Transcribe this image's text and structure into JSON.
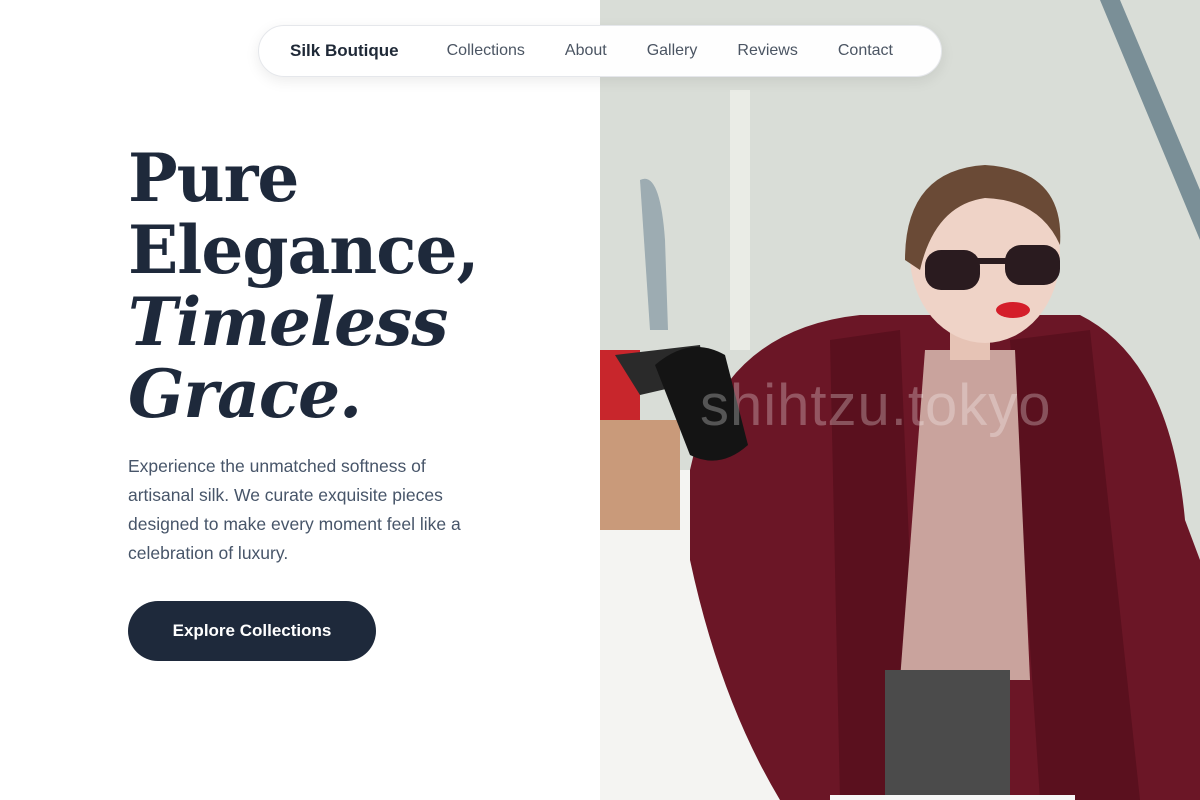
{
  "nav": {
    "brand": "Silk Boutique",
    "links": [
      "Collections",
      "About",
      "Gallery",
      "Reviews",
      "Contact"
    ]
  },
  "hero": {
    "headline_line1": "Pure",
    "headline_line2": "Elegance,",
    "headline_line3": "Timeless",
    "headline_line4": "Grace.",
    "description": "Experience the unmatched softness of artisanal silk. We curate exquisite pieces designed to make every moment feel like a celebration of luxury.",
    "cta_label": "Explore Collections",
    "image_watermark": "shihtzu.tokyo"
  },
  "colors": {
    "primary": "#1e293b",
    "text_muted": "#475569",
    "coat": "#6b1626",
    "background": "#ffffff"
  }
}
